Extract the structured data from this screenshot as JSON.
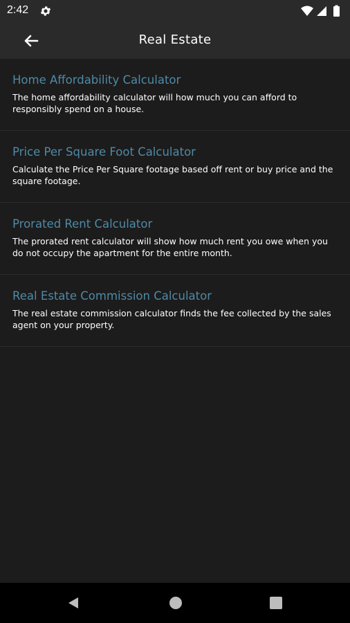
{
  "status_bar": {
    "time": "2:42",
    "icons": [
      "gear-icon",
      "wifi-icon",
      "signal-icon",
      "battery-icon"
    ]
  },
  "app_bar": {
    "title": "Real Estate",
    "back_icon": "arrow-left-icon"
  },
  "items": [
    {
      "title": "Home Affordability Calculator",
      "description": "The home affordability calculator will how much you can afford to responsibly spend on a house."
    },
    {
      "title": "Price Per Square Foot Calculator",
      "description": "Calculate the Price Per Square footage based off rent or buy price and the square footage."
    },
    {
      "title": "Prorated Rent Calculator",
      "description": "The prorated rent calculator will show how much rent you owe when you do not occupy the apartment for the entire month."
    },
    {
      "title": "Real Estate Commission Calculator",
      "description": "The real estate commission calculator finds the fee collected by the sales agent on your property."
    }
  ],
  "nav_bar": {
    "icons": [
      "nav-back-icon",
      "nav-home-icon",
      "nav-recent-icon"
    ]
  },
  "colors": {
    "background": "#1c1c1c",
    "app_bar": "#2a2a2a",
    "item_title": "#4f8aa6",
    "item_text": "#ffffff",
    "divider": "#2c2c2c",
    "nav_bar": "#000000"
  }
}
